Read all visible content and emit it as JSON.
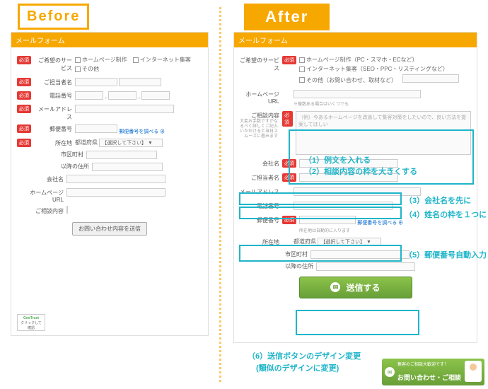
{
  "headings": {
    "before": "Before",
    "after": "After"
  },
  "formTitle": "メールフォーム",
  "badge": "必須",
  "before": {
    "fields": {
      "service": "ご希望のサービス",
      "name": "ご担当者名",
      "phone": "電話番号",
      "email": "メールアドレス",
      "postal": "郵便番号",
      "address": "所在地",
      "company": "会社名",
      "url": "ホームページURL",
      "content": "ご相談内容"
    },
    "options": {
      "hp": "ホームページ制作",
      "net": "インターネット集客",
      "other": "その他"
    },
    "postalLink": "郵便番号を調べる ⊕",
    "addr": {
      "pref": "都道府県",
      "prefSelect": "【選択して下さい】 ▼",
      "city": "市区町村",
      "line": "以降の住所"
    },
    "submit": "お問い合わせ内容を送信",
    "ssl": {
      "brand": "GeoTrust",
      "sub": "クリックして確認"
    }
  },
  "after": {
    "fields": {
      "service": "ご希望のサービス",
      "url": "ホームページURL",
      "content": "ご相談内容",
      "company": "会社名",
      "name": "ご担当者名",
      "email": "メールアドレス",
      "phone": "電話番号",
      "postal": "郵便番号",
      "address": "所在地"
    },
    "options": {
      "hp": "ホームページ制作（PC・スマホ・ECなど）",
      "net": "インターネット集客（SEO・PPC・リスティングなど）",
      "other": "その他（お問い合わせ、取材など）"
    },
    "urlNote": "※複数ある場合はいくつでも",
    "contentHelp": "大変お手数ですがなるべく詳しくご記入いただけると当日スムーズに進みます",
    "contentPlaceholder": "（例）今あるホームページを改善して集客対策をしたいので、良い方法を提案してほしい",
    "postalLink": "郵便番号を調べる ⊕",
    "postalNote": "所在地は自動的に入ります",
    "addr": {
      "pref": "都道府県",
      "prefSelect": "【選択して下さい】 ▼",
      "city": "市区町村",
      "line": "以降の住所"
    },
    "submit": "送信する"
  },
  "annotations": {
    "a1": "（1）例文を入れる",
    "a2": "（2）相談内容の枠を大きくする",
    "a3": "（3）会社名を先に",
    "a4": "（4）姓名の枠を１つに",
    "a5": "（5）郵便番号自動入力",
    "a6a": "（6）送信ボタンのデザイン変更",
    "a6b": "(類似のデザインに変更)"
  },
  "cta": {
    "line1": "集客のご相談大歓迎です！",
    "line2": "お問い合わせ・ご相談"
  }
}
